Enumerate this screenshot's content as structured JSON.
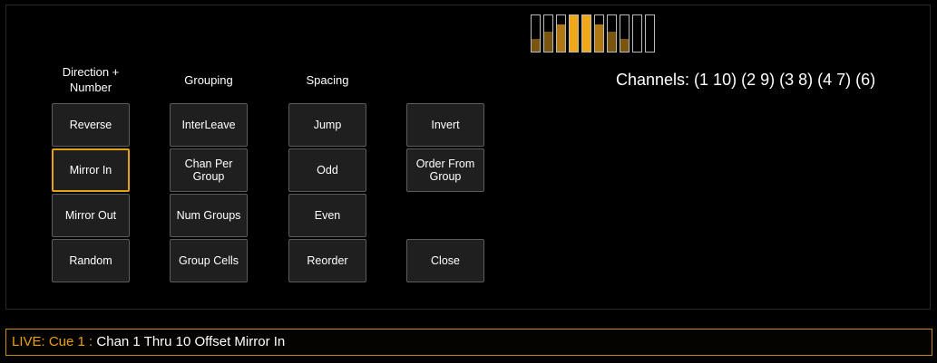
{
  "colors": {
    "accent": "#e8a017",
    "button_bg": "#1f1f1f",
    "button_border": "#5c5c5c"
  },
  "headers": {
    "direction": "Direction +\nNumber",
    "grouping": "Grouping",
    "spacing": "Spacing"
  },
  "direction_buttons": [
    "Reverse",
    "Mirror In",
    "Mirror Out",
    "Random"
  ],
  "grouping_buttons": [
    "InterLeave",
    "Chan Per Group",
    "Num Groups",
    "Group Cells"
  ],
  "spacing_buttons": [
    "Jump",
    "Odd",
    "Even",
    "Reorder"
  ],
  "action_buttons": {
    "invert": "Invert",
    "order_from_group": "Order From Group",
    "close": "Close"
  },
  "selected_option": "Mirror In",
  "channels_text": "Channels: (1 10) (2 9) (3 8) (4 7) (6)",
  "offset_pattern_levels": [
    0.35,
    0.55,
    0.75,
    1.0,
    1.0,
    0.75,
    0.55,
    0.35,
    0.0,
    0.0
  ],
  "command_line": {
    "prefix": "LIVE: Cue  1 : ",
    "text": " Chan 1 Thru 10 Offset Mirror In"
  }
}
